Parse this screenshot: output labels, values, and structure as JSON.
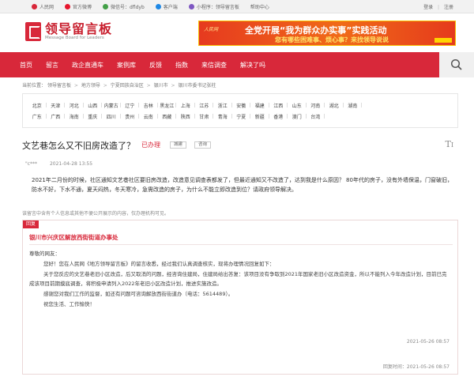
{
  "topbar": {
    "items": [
      {
        "label": "人民网",
        "icon": "people-icon",
        "color": "#d8283a"
      },
      {
        "label": "官方微博",
        "icon": "weibo-icon",
        "color": "#e6162d"
      },
      {
        "label": "微信号：dfldyb",
        "icon": "wechat-icon",
        "color": "#43a047"
      },
      {
        "label": "客户端",
        "icon": "app-icon",
        "color": "#1e88e5"
      },
      {
        "label": "小程序：领导留言板",
        "icon": "miniprogram-icon",
        "color": "#7e57c2"
      },
      {
        "label": "帮助中心",
        "icon": "help-icon",
        "color": "#999999"
      }
    ],
    "login": "登录",
    "divider": "|",
    "register": "注册"
  },
  "logo": {
    "cn": "领导留言板",
    "en": "Message Board for Leaders"
  },
  "banner": {
    "logo_text": "人民网",
    "title": "全党开展“我为群众办实事”实践活动",
    "subtitle": "您有哪些困难事、烦心事？来找领导说说"
  },
  "nav": {
    "items": [
      "首页",
      "留言",
      "政企直通车",
      "案例库",
      "反馈",
      "指数",
      "来信调查",
      "解决了吗"
    ],
    "search_icon": "search-icon"
  },
  "breadcrumb": [
    "当前位置：",
    "领导留言板",
    "地方领导",
    "宁夏回族自治区",
    "银川市",
    "银川市委书记张柱"
  ],
  "regions": {
    "row1": [
      "北京",
      "天津",
      "河北",
      "山西",
      "内蒙古",
      "辽宁",
      "吉林",
      "黑龙江",
      "上海",
      "江苏",
      "浙江",
      "安徽",
      "福建",
      "江西",
      "山东",
      "河南",
      "湖北",
      "湖南"
    ],
    "row2": [
      "广东",
      "广西",
      "海南",
      "重庆",
      "四川",
      "贵州",
      "云南",
      "西藏",
      "陕西",
      "甘肃",
      "青海",
      "宁夏",
      "新疆",
      "香港",
      "澳门",
      "台湾"
    ]
  },
  "message": {
    "title": "文艺巷怎么又不旧房改造了？",
    "status": "已办理",
    "tags": [
      "城建",
      "咨询"
    ],
    "author": "\"c***",
    "time": "2021-04-28 13:55",
    "body": "2021年二月份的时候，社区通知文艺巷社区要旧房改造，改造意见调查表都发了，但最近通知又不改造了，达到我是什么原因？ 80年代的房子，没有外墙保温，门窗破旧，防水不好，下水不通，夏天闷热，冬天寒冷，急需改造的房子，为什么不能立即改造到位？请政府领导解决。",
    "notice": "该留言中含有个人信息或其他不便公开展示的内容，仅办理机构可见。"
  },
  "reply": {
    "label": "回复",
    "org": "银川市兴庆区解放西街街道办事处",
    "greeting": "尊敬的网友：",
    "p1": "您好！您在人民网《地方领导留言板》的留言收悉，经过我们认真调查核实，现将办理情况回复如下：",
    "p2": "关于您反应的文艺巷老旧小区改造，后又取消的问题，经咨询住建局，住建局给出答复：该项目没有争取到2021年国家老旧小区改造资金，所以不能列入今年改造计划，目前已完成该项目前期摸底调查，将积极申请列入2022年老旧小区改造计划，推进实施改造。",
    "p3": "感谢您对我们工作的监督，如还有问题可咨询解放西街街道办（电话：5614489）。",
    "p4": "祝您生活、工作愉快！",
    "date": "2021-05-26 08:57",
    "sign": "回复时间"
  }
}
